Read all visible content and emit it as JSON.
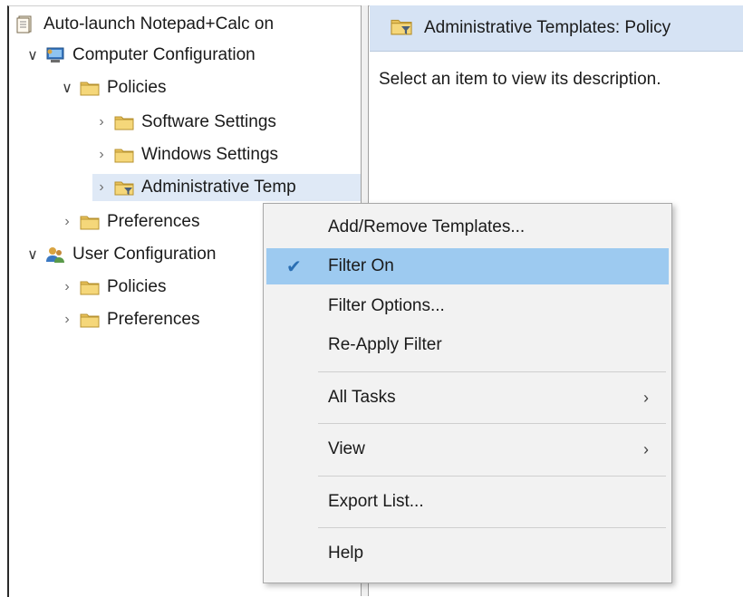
{
  "tree": {
    "root": "Auto-launch Notepad+Calc on",
    "computer_config": "Computer Configuration",
    "cc_policies": "Policies",
    "software_settings": "Software Settings",
    "windows_settings": "Windows Settings",
    "admin_templates": "Administrative Temp",
    "cc_preferences": "Preferences",
    "user_config": "User Configuration",
    "uc_policies": "Policies",
    "uc_preferences": "Preferences"
  },
  "right_pane": {
    "header_title": "Administrative Templates: Policy",
    "description": "Select an item to view its description."
  },
  "context_menu": {
    "add_remove": "Add/Remove Templates...",
    "filter_on": "Filter On",
    "filter_options": "Filter Options...",
    "reapply": "Re-Apply Filter",
    "all_tasks": "All Tasks",
    "view": "View",
    "export": "Export List...",
    "help": "Help"
  },
  "colors": {
    "selection": "#9dcaf0",
    "header_bg": "#d6e3f4",
    "folder": "#e8c15a"
  }
}
